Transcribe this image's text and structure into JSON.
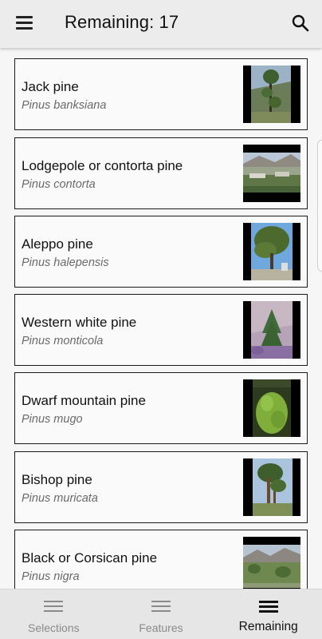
{
  "header": {
    "title": "Remaining: 17",
    "menu_icon": "hamburger-menu-icon",
    "search_icon": "search-icon"
  },
  "species": [
    {
      "common": "Jack pine",
      "latin": "Pinus banksiana"
    },
    {
      "common": "Lodgepole or contorta pine",
      "latin": "Pinus contorta"
    },
    {
      "common": "Aleppo pine",
      "latin": "Pinus halepensis"
    },
    {
      "common": "Western white pine",
      "latin": "Pinus monticola"
    },
    {
      "common": "Dwarf mountain pine",
      "latin": "Pinus mugo"
    },
    {
      "common": "Bishop pine",
      "latin": "Pinus muricata"
    },
    {
      "common": "Black or Corsican pine",
      "latin": "Pinus nigra"
    }
  ],
  "bottom_nav": {
    "items": [
      {
        "label": "Selections",
        "icon": "list-icon"
      },
      {
        "label": "Features",
        "icon": "list-icon"
      },
      {
        "label": "Remaining",
        "icon": "list-icon"
      }
    ],
    "active": "Remaining"
  },
  "colors": {
    "top_bar": "#ececec",
    "bottom_nav": "#e6e6e6",
    "card_border": "#1a1a1a",
    "latin_text": "#6a6a6a",
    "inactive_nav": "#8a8a8a"
  }
}
